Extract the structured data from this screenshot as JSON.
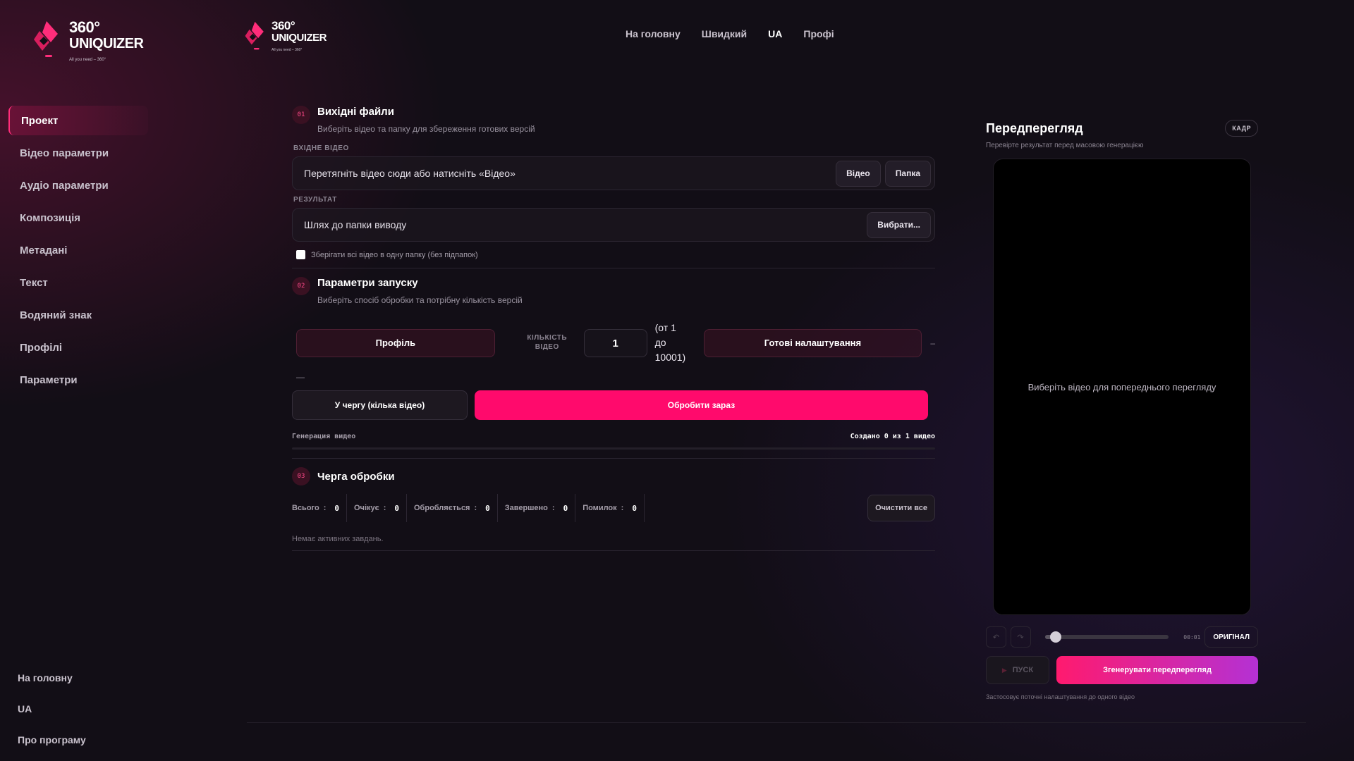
{
  "brand": {
    "line1": "360°",
    "line2": "UNIQUIZER",
    "tagline": "All you need – 360°"
  },
  "colors": {
    "accent": "#ff0a6c",
    "accent_gradient_end": "#b431d4"
  },
  "sidebar": {
    "items": [
      {
        "label": "Проект"
      },
      {
        "label": "Відео параметри"
      },
      {
        "label": "Аудіо параметри"
      },
      {
        "label": "Композиція"
      },
      {
        "label": "Метадані"
      },
      {
        "label": "Текст"
      },
      {
        "label": "Водяний знак"
      },
      {
        "label": "Профілі"
      },
      {
        "label": "Параметри"
      }
    ],
    "active_index": 0,
    "bottom": [
      {
        "label": "На головну"
      },
      {
        "label": "UA"
      },
      {
        "label": "Про програму"
      }
    ]
  },
  "top_nav": [
    {
      "label": "На головну"
    },
    {
      "label": "Швидкий"
    },
    {
      "label": "UA"
    },
    {
      "label": "Профі"
    }
  ],
  "section1": {
    "num": "01",
    "title": "Вихідні файли",
    "subtitle": "Виберіть відео та папку для збереження готових версій",
    "input_label": "ВХІДНЕ ВІДЕО",
    "input_placeholder": "Перетягніть відео сюди або натисніть «Відео»",
    "btn_video": "Відео",
    "btn_folder": "Папка",
    "result_label": "РЕЗУЛЬТАТ",
    "result_placeholder": "Шлях до папки виводу",
    "btn_choose": "Вибрати...",
    "checkbox_label": "Зберігати всі відео в одну папку (без підпапок)",
    "checkbox_checked": false
  },
  "section2": {
    "num": "02",
    "title": "Параметри запуску",
    "subtitle": "Виберіть спосіб обробки та потрібну кількість версій",
    "profile_btn": "Профіль",
    "qty_label_1": "КІЛЬКІСТЬ",
    "qty_label_2": "ВІДЕО",
    "qty_value": "1",
    "qty_range_1": "(от 1",
    "qty_range_2": "до",
    "qty_range_3": "10001)",
    "presets_btn": "Готові налаштування",
    "dash_right": "–",
    "dash_left": "—",
    "queue_btn": "У чергу (кілька відео)",
    "process_btn": "Обробити зараз",
    "progress_label": "Генерация видео",
    "progress_status": "Создано 0 из 1 видео",
    "progress_fraction": 0
  },
  "section3": {
    "num": "03",
    "title": "Черга обробки",
    "stats": [
      {
        "label": "Всього",
        "value": "0"
      },
      {
        "label": "Очікує",
        "value": "0"
      },
      {
        "label": "Обробляється",
        "value": "0"
      },
      {
        "label": "Завершено",
        "value": "0"
      },
      {
        "label": "Помилок",
        "value": "0"
      }
    ],
    "clear_btn": "Очистити все",
    "empty_text": "Немає активних завдань."
  },
  "preview": {
    "title": "Передперегляд",
    "badge": "КАДР",
    "subtitle": "Перевірте результат перед масовою генерацією",
    "placeholder": "Виберіть відео для попереднього перегляду",
    "undo_icon": "↶",
    "redo_icon": "↷",
    "slider_value": 0.09,
    "time": "00:01",
    "original_btn": "ОРИГІНАЛ",
    "play_icon": "▶",
    "play_btn": "ПУСК",
    "generate_btn": "Згенерувати передперегляд",
    "note": "Застосовує поточні налаштування до одного відео"
  }
}
